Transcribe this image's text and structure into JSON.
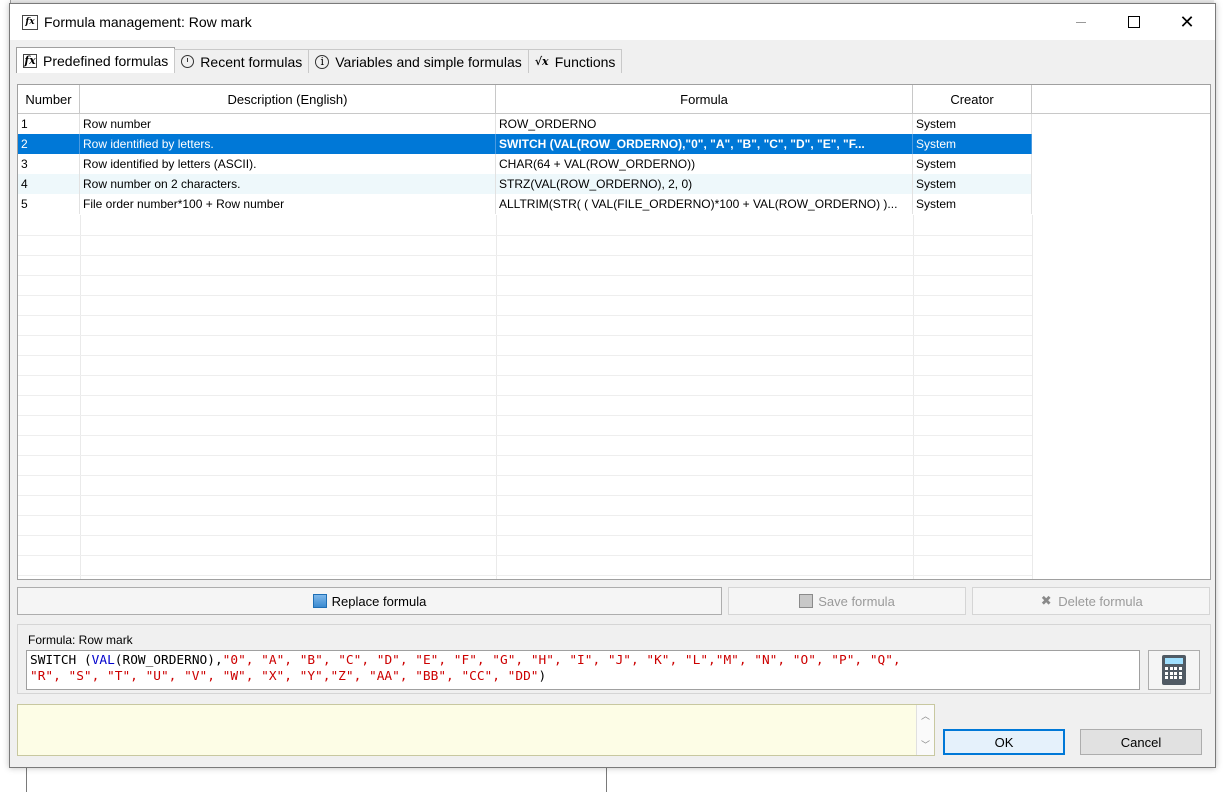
{
  "window": {
    "title": "Formula management: Row mark",
    "controls": {
      "minimize_icon": "minimize-icon",
      "maximize_icon": "maximize-icon",
      "close_glyph": "✕"
    }
  },
  "tabs": [
    {
      "label": "Predefined formulas",
      "icon": "fx-icon",
      "active": true
    },
    {
      "label": "Recent formulas",
      "icon": "clock-icon",
      "active": false
    },
    {
      "label": "Variables and simple formulas",
      "icon": "info-icon",
      "active": false
    },
    {
      "label": "Functions",
      "icon": "sqrt-x-icon",
      "active": false
    }
  ],
  "grid": {
    "columns": [
      "Number",
      "Description (English)",
      "Formula",
      "Creator"
    ],
    "rows": [
      {
        "number": "1",
        "description": "Row number",
        "formula": "ROW_ORDERNO",
        "creator": "System",
        "selected": false
      },
      {
        "number": "2",
        "description": "Row identified by letters.",
        "formula": "SWITCH (VAL(ROW_ORDERNO),\"0\", \"A\", \"B\", \"C\", \"D\", \"E\", \"F...",
        "creator": "System",
        "selected": true
      },
      {
        "number": "3",
        "description": "Row identified by letters (ASCII).",
        "formula": "CHAR(64 + VAL(ROW_ORDERNO))",
        "creator": "System",
        "selected": false
      },
      {
        "number": "4",
        "description": "Row number on 2 characters.",
        "formula": "STRZ(VAL(ROW_ORDERNO), 2, 0)",
        "creator": "System",
        "selected": false
      },
      {
        "number": "5",
        "description": "File order number*100 + Row number",
        "formula": "ALLTRIM(STR( ( VAL(FILE_ORDERNO)*100 + VAL(ROW_ORDERNO) )...",
        "creator": "System",
        "selected": false
      }
    ]
  },
  "actions": {
    "replace": "Replace formula",
    "save": "Save formula",
    "delete": "Delete formula"
  },
  "formula_panel": {
    "label": "Formula: Row mark",
    "line1": {
      "fn": "SWITCH",
      "paren_open": " (",
      "kw": "VAL",
      "arg": "(ROW_ORDERNO),",
      "strings": "\"0\", \"A\", \"B\", \"C\", \"D\", \"E\", \"F\", \"G\", \"H\", \"I\", \"J\", \"K\", \"L\",\"M\", \"N\", \"O\", \"P\", \"Q\","
    },
    "line2": {
      "strings": "\"R\", \"S\", \"T\", \"U\", \"V\", \"W\", \"X\", \"Y\",\"Z\", \"AA\", \"BB\", \"CC\", \"DD\"",
      "close": ")"
    },
    "calculator_icon": "calculator-icon"
  },
  "message": "",
  "buttons": {
    "ok": "OK",
    "cancel": "Cancel"
  }
}
